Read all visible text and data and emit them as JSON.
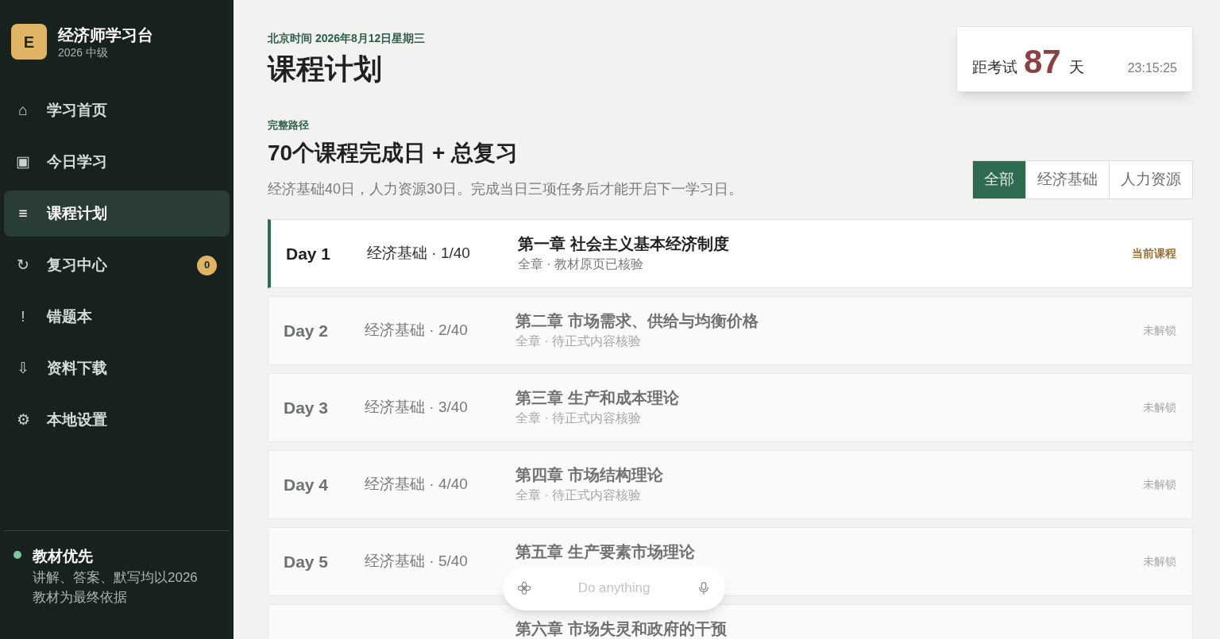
{
  "brand": {
    "logo": "E",
    "title": "经济师学习台",
    "subtitle": "2026 中级"
  },
  "nav": [
    {
      "icon": "⌂",
      "label": "学习首页",
      "selected": false
    },
    {
      "icon": "▣",
      "label": "今日学习",
      "selected": false
    },
    {
      "icon": "≡",
      "label": "课程计划",
      "selected": true
    },
    {
      "icon": "↻",
      "label": "复习中心",
      "selected": false,
      "badge": "0"
    },
    {
      "icon": "!",
      "label": "错题本",
      "selected": false
    },
    {
      "icon": "⇩",
      "label": "资料下载",
      "selected": false
    },
    {
      "icon": "⚙",
      "label": "本地设置",
      "selected": false
    }
  ],
  "note": {
    "title": "教材优先",
    "text": "讲解、答案、默写均以2026教材为最终依据",
    "color": "#7fc79a"
  },
  "header": {
    "date": "北京时间 2026年8月12日星期三",
    "title": "课程计划"
  },
  "countdown": {
    "prefix": "距考试",
    "days": "87",
    "unit": "天",
    "time": "23:15:25"
  },
  "section": {
    "eyebrow": "完整路径",
    "title": "70个课程完成日 + 总复习",
    "description": "经济基础40日，人力资源30日。完成当日三项任务后才能开启下一学习日。"
  },
  "filters": [
    {
      "label": "全部",
      "selected": true
    },
    {
      "label": "经济基础",
      "selected": false
    },
    {
      "label": "人力资源",
      "selected": false
    }
  ],
  "lessons": [
    {
      "day": "Day 1",
      "track": "经济基础 · 1/40",
      "title": "第一章 社会主义基本经济制度",
      "subtitle": "全章 · 教材原页已核验",
      "status": "当前课程",
      "current": true
    },
    {
      "day": "Day 2",
      "track": "经济基础 · 2/40",
      "title": "第二章 市场需求、供给与均衡价格",
      "subtitle": "全章 · 待正式内容核验",
      "status": "未解锁",
      "current": false
    },
    {
      "day": "Day 3",
      "track": "经济基础 · 3/40",
      "title": "第三章 生产和成本理论",
      "subtitle": "全章 · 待正式内容核验",
      "status": "未解锁",
      "current": false
    },
    {
      "day": "Day 4",
      "track": "经济基础 · 4/40",
      "title": "第四章 市场结构理论",
      "subtitle": "全章 · 待正式内容核验",
      "status": "未解锁",
      "current": false
    },
    {
      "day": "Day 5",
      "track": "经济基础 · 5/40",
      "title": "第五章 生产要素市场理论",
      "status": "未解锁",
      "current": false
    },
    {
      "title": "第六章 市场失灵和政府的干预",
      "current": false
    }
  ],
  "assistant": {
    "placeholder": "Do anything"
  }
}
